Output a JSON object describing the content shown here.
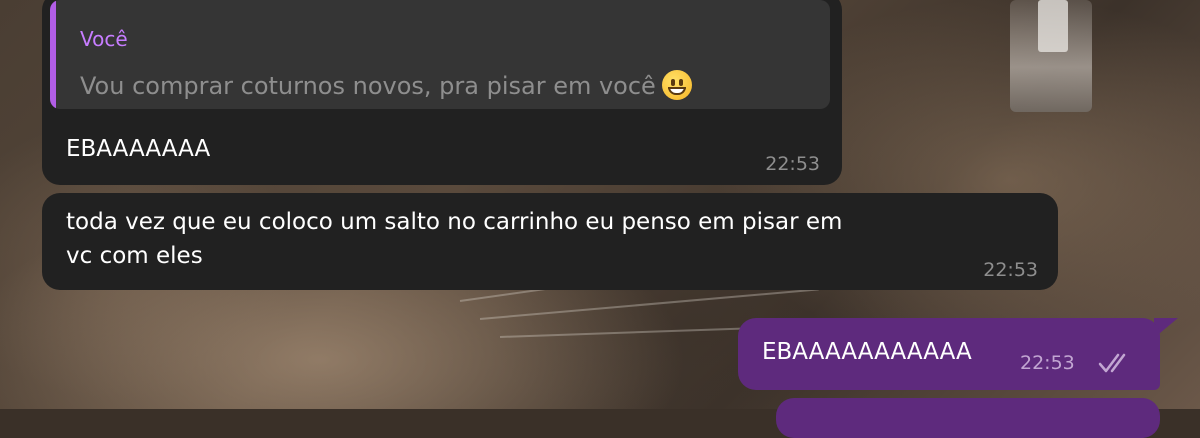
{
  "messages": [
    {
      "direction": "incoming",
      "reply": {
        "author": "Você",
        "text": "Vou comprar coturnos novos, pra pisar em você",
        "emoji_icon": "grinning-face-emoji"
      },
      "text": "EBAAAAAAA",
      "time": "22:53"
    },
    {
      "direction": "incoming",
      "lines": [
        "toda vez que eu coloco um salto no carrinho eu penso em pisar em",
        "vc com eles"
      ],
      "time": "22:53"
    },
    {
      "direction": "outgoing",
      "text": "EBAAAAAAAAAAA",
      "time": "22:53",
      "status_icon": "double-check-icon"
    }
  ],
  "colors": {
    "incoming_bubble": "#212121",
    "reply_background": "#353535",
    "reply_accent": "#b25ee6",
    "reply_author": "#c77dff",
    "outgoing_bubble": "#5e2a7d",
    "timestamp": "#8e8e8e"
  }
}
